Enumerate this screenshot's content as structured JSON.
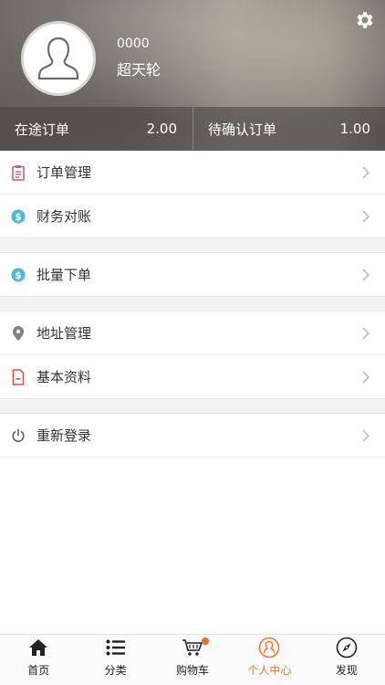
{
  "profile": {
    "user_id": "0000",
    "user_name": "超天轮"
  },
  "stats": {
    "in_transit_label": "在途订单",
    "in_transit_value": "2.00",
    "pending_label": "待确认订单",
    "pending_value": "1.00"
  },
  "menu": {
    "order_management": "订单管理",
    "finance_reconciliation": "财务对账",
    "bulk_order": "批量下单",
    "address_management": "地址管理",
    "basic_info": "基本资料",
    "relogin": "重新登录"
  },
  "tabs": {
    "home": "首页",
    "category": "分类",
    "cart": "购物车",
    "personal_center": "个人中心",
    "discover": "发现"
  },
  "colors": {
    "accent": "#ee7a34",
    "finance_icon": "#4fb8d8",
    "order_icon": "#c95a8a",
    "doc_icon": "#e0503a"
  }
}
